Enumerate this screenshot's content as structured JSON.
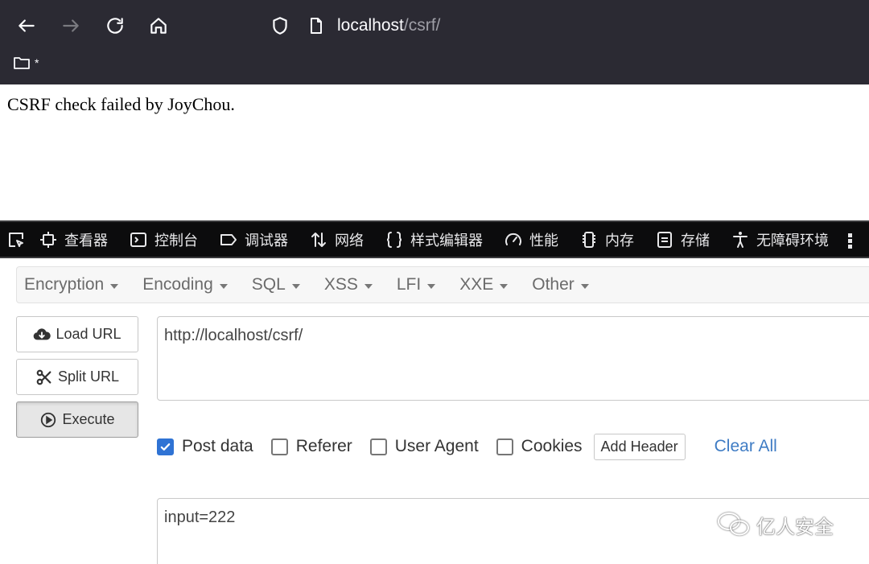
{
  "browser": {
    "url_host": "localhost",
    "url_path": "/csrf/",
    "bookmark_label": "*"
  },
  "page": {
    "message": "CSRF check failed by JoyChou."
  },
  "devtools": {
    "tabs": [
      {
        "label": "查看器",
        "icon": "inspector-icon"
      },
      {
        "label": "控制台",
        "icon": "console-icon"
      },
      {
        "label": "调试器",
        "icon": "debugger-icon"
      },
      {
        "label": "网络",
        "icon": "network-icon"
      },
      {
        "label": "样式编辑器",
        "icon": "style-editor-icon"
      },
      {
        "label": "性能",
        "icon": "performance-icon"
      },
      {
        "label": "内存",
        "icon": "memory-icon"
      },
      {
        "label": "存储",
        "icon": "storage-icon"
      },
      {
        "label": "无障碍环境",
        "icon": "accessibility-icon"
      }
    ]
  },
  "hackbar": {
    "menu": [
      "Encryption",
      "Encoding",
      "SQL",
      "XSS",
      "LFI",
      "XXE",
      "Other"
    ],
    "load_url": "Load URL",
    "split_url": "Split URL",
    "execute": "Execute",
    "url_value": "http://localhost/csrf/",
    "options": [
      {
        "label": "Post data",
        "checked": true
      },
      {
        "label": "Referer",
        "checked": false
      },
      {
        "label": "User Agent",
        "checked": false
      },
      {
        "label": "Cookies",
        "checked": false
      }
    ],
    "add_header": "Add Header",
    "clear_all": "Clear All",
    "post_value": "input=222"
  },
  "watermark": {
    "text": "亿人安全"
  },
  "colors": {
    "chrome_bg": "#2b2a33",
    "devtools_bg": "#0c0c0d",
    "accent_blue": "#2f73d4",
    "link_blue": "#3f7cc4"
  }
}
